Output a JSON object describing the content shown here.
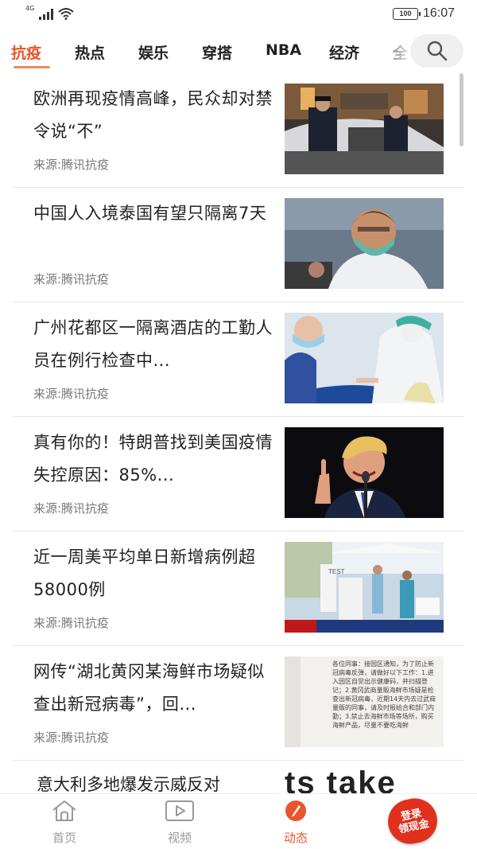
{
  "status_bar": {
    "network": "4G",
    "battery": "100",
    "time": "16:07"
  },
  "tabs": [
    {
      "label": "抗疫",
      "active": true
    },
    {
      "label": "热点"
    },
    {
      "label": "娱乐"
    },
    {
      "label": "穿搭"
    },
    {
      "label": "NBA"
    },
    {
      "label": "经济"
    },
    {
      "label": "全"
    }
  ],
  "search": {
    "icon": "search-icon"
  },
  "news": [
    {
      "title": " 欧洲再现疫情高峰，民众却对禁令说“不”",
      "source": "来源:腾讯抗疫"
    },
    {
      "title": "中国人入境泰国有望只隔离7天",
      "source": "来源:腾讯抗疫"
    },
    {
      "title": "广州花都区一隔离酒店的工勤人员在例行检查中...",
      "source": "来源:腾讯抗疫"
    },
    {
      "title": " 真有你的！特朗普找到美国疫情失控原因：85%...",
      "source": "来源:腾讯抗疫"
    },
    {
      "title": "近一周美平均单日新增病例超58000例",
      "source": "来源:腾讯抗疫"
    },
    {
      "title": "网传“湖北黄冈某海鲜市场疑似查出新冠病毒”，回...",
      "source": "来源:腾讯抗疫"
    }
  ],
  "partial_news": {
    "title": " 意大利多地爆发示威反对"
  },
  "thumb_text": {
    "news4_banner": "TEST",
    "news5_notice": "各位同事：接园区通知，为了防止新冠病毒反弹，请做好以下工作：1.进入园区自觉出示健康码，并扫描登记；2.黄冈武商量贩海鲜市场疑是检查出新冠病毒，近期14天内去过武商量贩的同事，请及时报给合和部门内勤；3.禁止去海鲜市场等场所，购买海鲜产品，尽量不要吃海鲜",
    "partial_banner": "ts take"
  },
  "bottom_nav": [
    {
      "label": "首页",
      "icon": "home-icon"
    },
    {
      "label": "视频",
      "icon": "video-icon"
    },
    {
      "label": "动态",
      "icon": "feed-icon",
      "active": true
    }
  ],
  "reward": {
    "line1": "登录",
    "line2": "领现金"
  },
  "colors": {
    "accent": "#e8552a",
    "reward_red": "#e0311e"
  }
}
